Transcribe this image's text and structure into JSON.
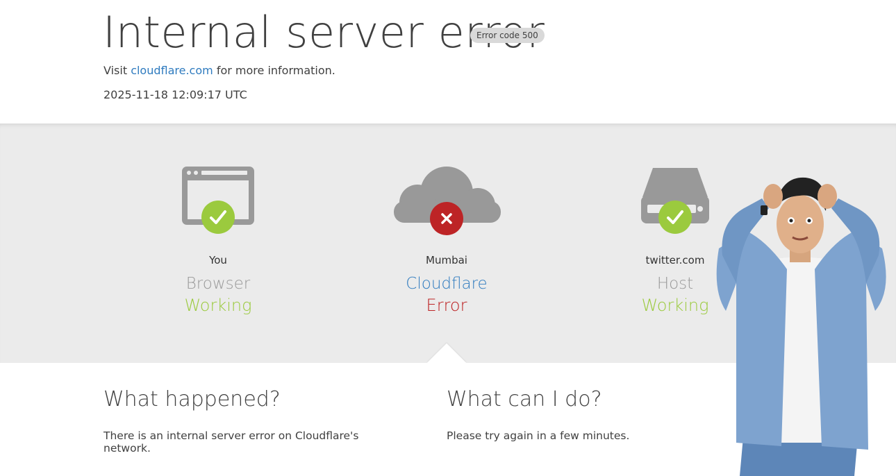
{
  "header": {
    "title": "Internal server error",
    "error_badge": "Error code 500",
    "visit_prefix": "Visit",
    "visit_link": "cloudflare.com",
    "visit_suffix": "for more information.",
    "timestamp": "2025-11-18 12:09:17 UTC"
  },
  "nodes": [
    {
      "location": "You",
      "name": "Browser",
      "status": "Working",
      "state": "ok",
      "icon": "browser-window-icon"
    },
    {
      "location": "Mumbai",
      "name": "Cloudflare",
      "status": "Error",
      "state": "error",
      "icon": "cloud-icon"
    },
    {
      "location": "twitter.com",
      "name": "Host",
      "status": "Working",
      "state": "ok",
      "icon": "server-icon"
    }
  ],
  "info": {
    "what_happened_title": "What happened?",
    "what_happened_text": "There is an internal server error on Cloudflare's network.",
    "what_can_i_do_title": "What can I do?",
    "what_can_i_do_text": "Please try again in a few minutes."
  },
  "colors": {
    "link": "#2f7bbf",
    "ok": "#9bca3e",
    "error": "#bd2426",
    "icon_gray": "#999999",
    "band": "#ebebeb"
  }
}
